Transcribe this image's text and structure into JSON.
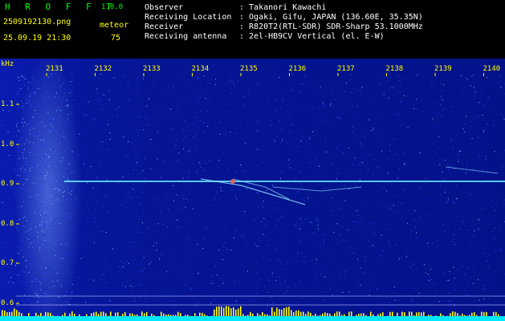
{
  "header": {
    "app_name": "H R O F F T",
    "version": "1.0.0",
    "filename": "2509192130.png",
    "datetime": "25.09.19 21:30",
    "counter_label": "meteor",
    "counter_value": "75",
    "info": [
      {
        "label": "Observer",
        "value": ": Takanori Kawachi"
      },
      {
        "label": "Receiving Location",
        "value": ": Ogaki, Gifu, JAPAN (136.60E, 35.35N)"
      },
      {
        "label": "Receiver",
        "value": ": R820T2(RTL-SDR) SDR-Sharp 53.1000MHz"
      },
      {
        "label": "Receiving antenna",
        "value": ": 2el-HB9CV Vertical (el. E-W)"
      }
    ]
  },
  "spectrogram": {
    "y_unit": "kHz",
    "time_ticks": [
      "2131",
      "2132",
      "2133",
      "2134",
      "2135",
      "2136",
      "2137",
      "2138",
      "2139",
      "2140"
    ],
    "freq_ticks": [
      "1.1",
      "1.0",
      "0.9",
      "0.8",
      "0.7",
      "0.6"
    ],
    "colors": {
      "background": "#0a1cb0",
      "carrier": "#66e8ff",
      "text": "#ffff00",
      "echo_bar": "#ffff00",
      "floor": "#00e8ff"
    }
  }
}
